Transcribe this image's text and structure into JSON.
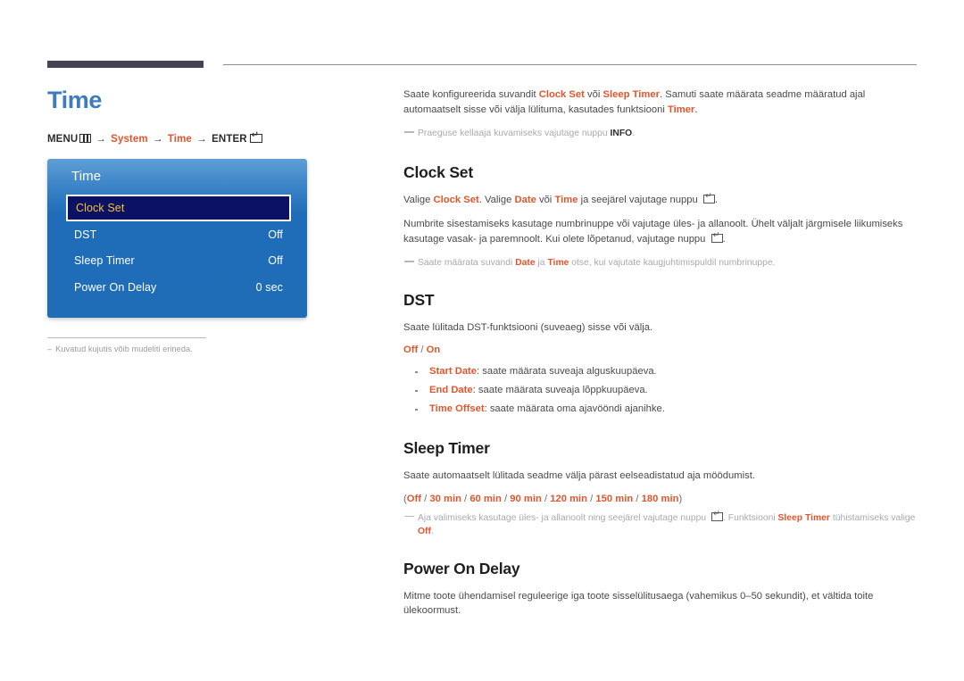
{
  "header": {
    "rule_thick_color": "#464354",
    "rule_thin_color": "#8d8d93"
  },
  "left": {
    "page_title": "Time",
    "breadcrumb": {
      "menu_label": "MENU",
      "menu_icon": "menu-grid-icon",
      "arrow": "→",
      "item1": "System",
      "item2": "Time",
      "enter_label": "ENTER",
      "enter_icon": "enter-key-icon"
    },
    "osd": {
      "title": "Time",
      "rows": [
        {
          "label": "Clock Set",
          "value": "",
          "selected": true
        },
        {
          "label": "DST",
          "value": "Off",
          "selected": false
        },
        {
          "label": "Sleep Timer",
          "value": "Off",
          "selected": false
        },
        {
          "label": "Power On Delay",
          "value": "0 sec",
          "selected": false
        }
      ],
      "colors": {
        "panel_top": "#5f9fd6",
        "panel_body": "#1f6cb7",
        "selected_bg": "#0c1263",
        "selected_text": "#f3c13a"
      }
    },
    "footnote": {
      "dash": "–",
      "text": "Kuvatud kujutis võib mudeliti erineda."
    }
  },
  "right": {
    "intro": {
      "p1_a": "Saate konfigureerida suvandit ",
      "p1_b": "Clock Set",
      "p1_c": " või ",
      "p1_d": "Sleep Timer",
      "p1_e": ". Samuti saate määrata seadme määratud ajal automaatselt sisse või välja lülituma, kasutades funktsiooni ",
      "p1_f": "Timer",
      "p1_g": ".",
      "note_a": "Praeguse kellaaja kuvamiseks vajutage nuppu ",
      "note_b": "INFO",
      "note_c": "."
    },
    "clock_set": {
      "heading": "Clock Set",
      "p1_a": "Valige ",
      "p1_b": "Clock Set",
      "p1_c": ". Valige ",
      "p1_d": "Date",
      "p1_e": " või ",
      "p1_f": "Time",
      "p1_g": " ja seejärel vajutage nuppu ",
      "p1_h": ".",
      "p2": "Numbrite sisestamiseks kasutage numbrinuppe või vajutage üles- ja allanoolt. Ühelt väljalt järgmisele liikumiseks kasutage vasak- ja paremnoolt. Kui olete lõpetanud, vajutage nuppu ",
      "p2_end": ".",
      "note_a": "Saate määrata suvandi ",
      "note_b": "Date",
      "note_c": " ja ",
      "note_d": "Time",
      "note_e": " otse, kui vajutate kaugjuhtimispuldil numbrinuppe."
    },
    "dst": {
      "heading": "DST",
      "p1": "Saate lülitada DST-funktsiooni (suveaeg) sisse või välja.",
      "options_off": "Off",
      "options_sep": " / ",
      "options_on": "On",
      "bullets": [
        {
          "term": "Start Date",
          "text": ": saate määrata suveaja alguskuupäeva."
        },
        {
          "term": "End Date",
          "text": ": saate määrata suveaja lõppkuupäeva."
        },
        {
          "term": "Time Offset",
          "text": ": saate määrata oma ajavööndi ajanihke."
        }
      ]
    },
    "sleep_timer": {
      "heading": "Sleep Timer",
      "p1": "Saate automaatselt lülitada seadme välja pärast eelseadistatud aja möödumist.",
      "paren_open": "(",
      "paren_close": ")",
      "options": [
        "Off",
        "30 min",
        "60 min",
        "90 min",
        "120 min",
        "150 min",
        "180 min"
      ],
      "options_sep": " / ",
      "note_a": "Aja valimiseks kasutage üles- ja allanoolt ning seejärel vajutage nuppu ",
      "note_b": ". Funktsiooni ",
      "note_c": "Sleep Timer",
      "note_d": " tühistamiseks valige ",
      "note_e": "Off",
      "note_f": "."
    },
    "power_on_delay": {
      "heading": "Power On Delay",
      "p1": "Mitme toote ühendamisel reguleerige iga toote sisselülitusaega (vahemikus 0–50 sekundit), et vältida toite ülekoormust."
    }
  }
}
